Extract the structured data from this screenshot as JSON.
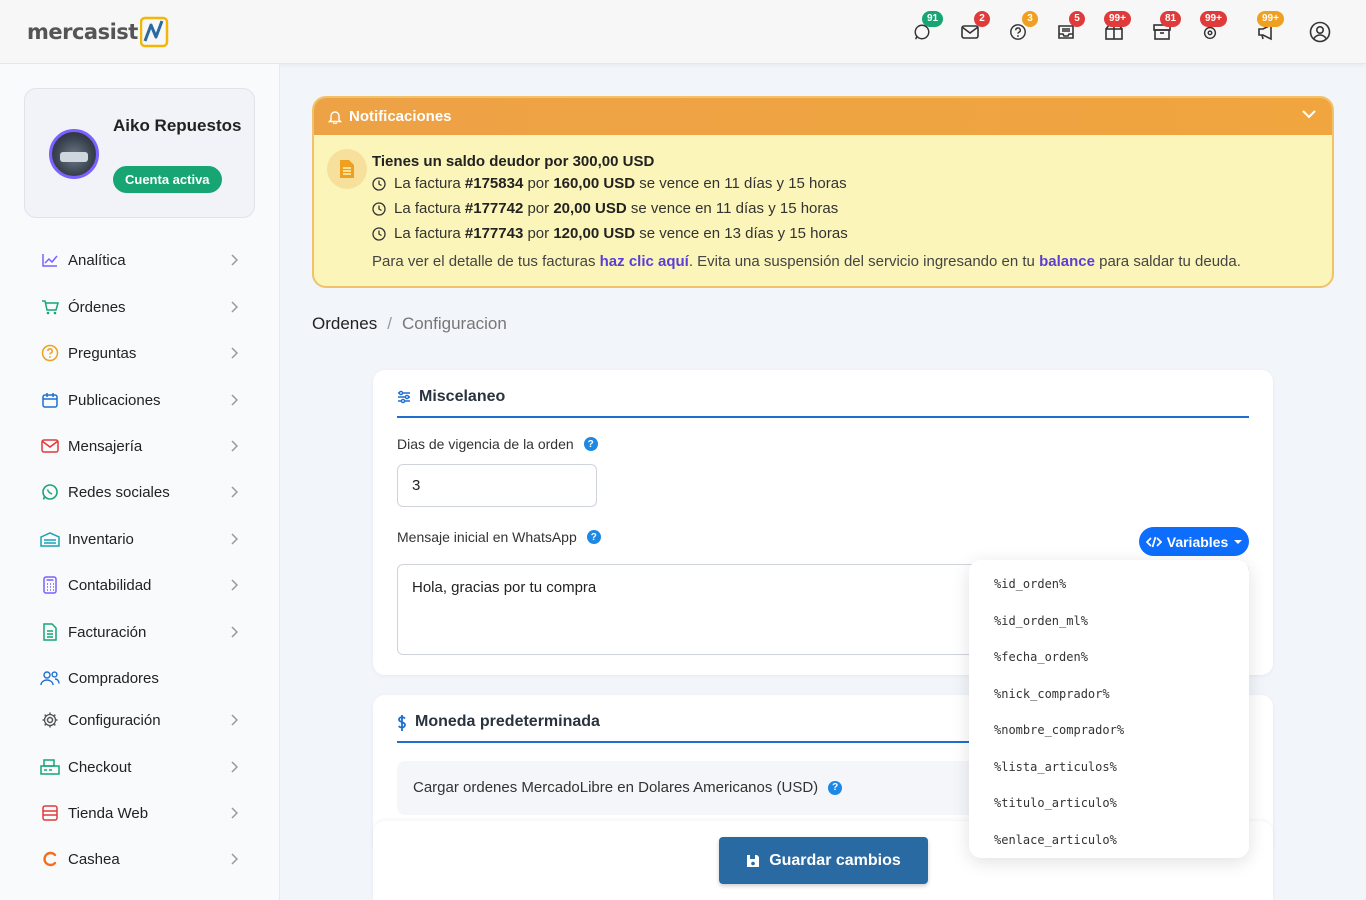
{
  "brand": {
    "name": "mercasist"
  },
  "topbar": {
    "icons": [
      {
        "icon": "whatsapp-icon",
        "badge": "91",
        "color": "#17a673"
      },
      {
        "icon": "mail-icon",
        "badge": "2",
        "color": "#e03b3b"
      },
      {
        "icon": "question-icon",
        "badge": "3",
        "color": "#f0a020"
      },
      {
        "icon": "inbox-icon",
        "badge": "5",
        "color": "#e03b3b"
      },
      {
        "icon": "box-icon",
        "badge": "99+",
        "color": "#e03b3b"
      },
      {
        "icon": "archive-icon",
        "badge": "81",
        "color": "#e03b3b"
      },
      {
        "icon": "gear-alert-icon",
        "badge": "99+",
        "color": "#e03b3b"
      },
      {
        "icon": "megaphone-icon",
        "badge": "99+",
        "color": "#f0a020"
      }
    ]
  },
  "profile": {
    "name": "Aiko Repuestos",
    "status": "Cuenta activa"
  },
  "sidebar": {
    "items": [
      {
        "label": "Analítica",
        "icon": "chart-line-icon",
        "color": "#7b61ff",
        "chevron": true
      },
      {
        "label": "Órdenes",
        "icon": "cart-icon",
        "color": "#17a673",
        "chevron": true
      },
      {
        "label": "Preguntas",
        "icon": "question-icon",
        "color": "#f0a020",
        "chevron": true
      },
      {
        "label": "Publicaciones",
        "icon": "calendar-icon",
        "color": "#1e6fd0",
        "chevron": true
      },
      {
        "label": "Mensajería",
        "icon": "mail-icon",
        "color": "#e03b3b",
        "chevron": true
      },
      {
        "label": "Redes sociales",
        "icon": "whatsapp-icon",
        "color": "#17a673",
        "chevron": true
      },
      {
        "label": "Inventario",
        "icon": "inventory-icon",
        "color": "#17a2b8",
        "chevron": true
      },
      {
        "label": "Contabilidad",
        "icon": "calculator-icon",
        "color": "#7b61ff",
        "chevron": true
      },
      {
        "label": "Facturación",
        "icon": "invoice-icon",
        "color": "#17a673",
        "chevron": true
      },
      {
        "label": "Compradores",
        "icon": "users-icon",
        "color": "#1e6fd0",
        "chevron": false
      },
      {
        "label": "Configuración",
        "icon": "gear-icon",
        "color": "#555555",
        "chevron": true
      },
      {
        "label": "Checkout",
        "icon": "cashier-icon",
        "color": "#17a673",
        "chevron": true
      },
      {
        "label": "Tienda Web",
        "icon": "store-icon",
        "color": "#e03b3b",
        "chevron": true
      },
      {
        "label": "Cashea",
        "icon": "cashea-icon",
        "color": "#f07020",
        "chevron": true
      }
    ]
  },
  "notifications": {
    "title": "Notificaciones",
    "heading": "Tienes un saldo deudor por 300,00 USD",
    "rows": [
      {
        "pre": "La factura",
        "invoice": "#175834",
        "mid": "por",
        "amount": "160,00 USD",
        "post": "se vence en 11 días y 15 horas"
      },
      {
        "pre": "La factura",
        "invoice": "#177742",
        "mid": "por",
        "amount": "20,00 USD",
        "post": "se vence en 11 días y 15 horas"
      },
      {
        "pre": "La factura",
        "invoice": "#177743",
        "mid": "por",
        "amount": "120,00 USD",
        "post": "se vence en 13 días y 15 horas"
      }
    ],
    "footer_pre": "Para ver el detalle de tus facturas",
    "footer_link": "haz clic aquí",
    "footer_mid": ". Evita una suspensión del servicio ingresando en tu",
    "footer_link2": "balance",
    "footer_post": "para saldar tu deuda."
  },
  "breadcrumb": {
    "current": "Ordenes",
    "separator": "/",
    "sub": "Configuracion"
  },
  "misc": {
    "title": "Miscelaneo",
    "days_label": "Dias de vigencia de la orden",
    "days_value": "3",
    "whatsapp_label": "Mensaje inicial en WhatsApp",
    "whatsapp_value": "Hola, gracias por tu compra",
    "variables_button": "Variables"
  },
  "variables": [
    "%id_orden%",
    "%id_orden_ml%",
    "%fecha_orden%",
    "%nick_comprador%",
    "%nombre_comprador%",
    "%lista_articulos%",
    "%titulo_articulo%",
    "%enlace_articulo%"
  ],
  "currency": {
    "title": "Moneda predeterminada",
    "usd_label": "Cargar ordenes MercadoLibre en Dolares Americanos (USD)"
  },
  "help_icon": "?",
  "save": {
    "label": "Guardar cambios"
  }
}
